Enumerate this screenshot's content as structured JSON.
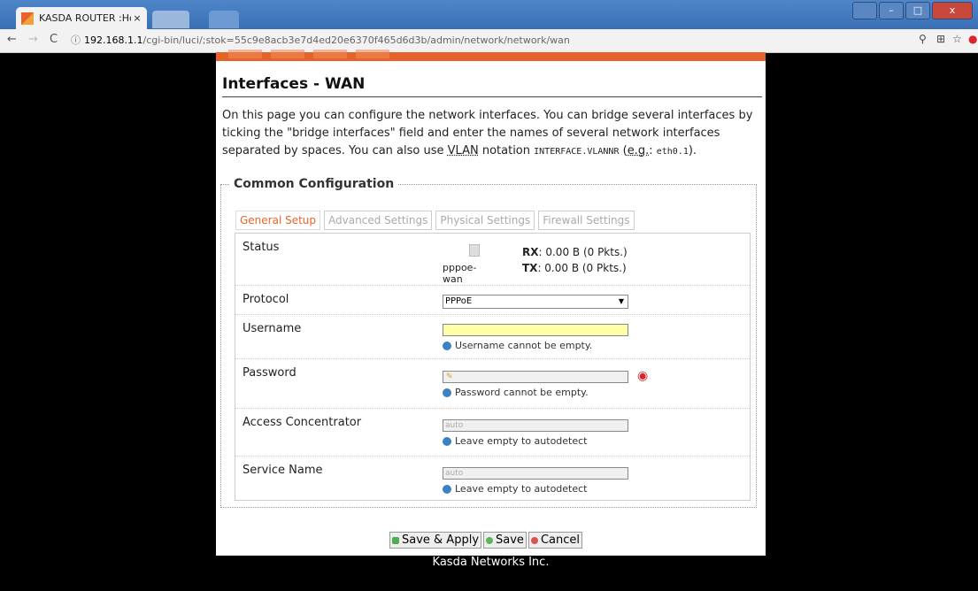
{
  "browser": {
    "tab_title": "KASDA ROUTER :Home",
    "tab_close": "×",
    "url_host": "192.168.1.1",
    "url_path": "/cgi-bin/luci/;stok=55c9e8acb3e7d4ed20e6370f465d6d3b/admin/network/network/wan"
  },
  "page": {
    "title": "Interfaces - WAN",
    "description_1": "On this page you can configure the network interfaces. You can bridge several interfaces by ticking the \"bridge interfaces\" field and enter the names of several network interfaces separated by spaces. You can also use ",
    "vlan": "VLAN",
    "notation": " notation ",
    "interface_vlannr": "INTERFACE.VLANNR",
    "eg_open": " (",
    "eg": "e.g.",
    "eg_colon": ": ",
    "eth": "eth0.1",
    "eg_close": ").",
    "fieldset_legend": "Common Configuration",
    "tabs": [
      "General Setup",
      "Advanced Settings",
      "Physical Settings",
      "Firewall Settings"
    ],
    "status_label": "Status",
    "status_ifname": "pppoe-wan",
    "rx_label": "RX",
    "rx_value": ": 0.00 B (0 Pkts.)",
    "tx_label": "TX",
    "tx_value": ": 0.00 B (0 Pkts.)",
    "protocol_label": "Protocol",
    "protocol_value": "PPPoE",
    "username_label": "Username",
    "username_value": "",
    "username_hint": "Username cannot be empty.",
    "password_label": "Password",
    "password_value": "",
    "password_hint": "Password cannot be empty.",
    "ac_label": "Access Concentrator",
    "ac_placeholder": "auto",
    "ac_hint": "Leave empty to autodetect",
    "service_label": "Service Name",
    "service_placeholder": "auto",
    "service_hint": "Leave empty to autodetect",
    "save_apply": "Save & Apply",
    "save": "Save",
    "cancel": "Cancel",
    "footer": "Kasda Networks Inc."
  }
}
